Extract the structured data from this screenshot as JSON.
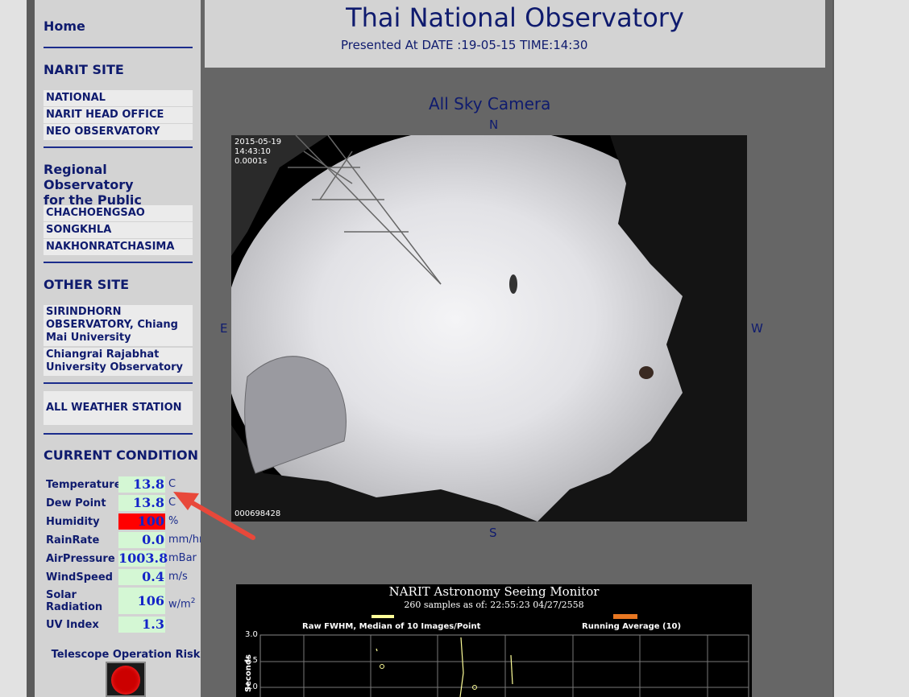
{
  "sidebar": {
    "home": "Home",
    "narit_site": {
      "heading": "NARIT SITE",
      "links": [
        "NATIONAL OBSERVATORY",
        "NARIT HEAD OFFICE",
        "NEO OBSERVATORY"
      ]
    },
    "regional": {
      "heading_line1": "Regional Observatory",
      "heading_line2": "for the Public",
      "links": [
        "CHACHOENGSAO",
        "SONGKHLA",
        "NAKHONRATCHASIMA"
      ]
    },
    "other_site": {
      "heading": "OTHER SITE",
      "links": [
        [
          "SIRINDHORN",
          "OBSERVATORY, Chiang",
          "Mai University"
        ],
        [
          "Chiangrai Rajabhat",
          "University Observatory"
        ]
      ]
    },
    "all_weather": "ALL WEATHER STATION",
    "current_condition": {
      "heading": "CURRENT CONDITION",
      "rows": [
        {
          "label": "Temperature",
          "value": "13.8",
          "unit": "C"
        },
        {
          "label": "Dew Point",
          "value": "13.8",
          "unit": "C"
        },
        {
          "label": "Humidity",
          "value": "100",
          "unit": "%"
        },
        {
          "label": "RainRate",
          "value": "0.0",
          "unit": "mm/hr"
        },
        {
          "label": "AirPressure",
          "value": "1003.8",
          "unit": "mBar"
        },
        {
          "label": "WindSpeed",
          "value": "0.4",
          "unit": "m/s"
        },
        {
          "label_line1": "Solar",
          "label_line2": "Radiation",
          "value": "106",
          "unit": "w/m",
          "unit_sup": "2"
        },
        {
          "label": "UV Index",
          "value": "1.3",
          "unit": ""
        }
      ],
      "humidity_alert_color": "#ff0000"
    },
    "telescope_risk": "Telescope Operation Risk",
    "risk_light_color": "#cc0000"
  },
  "main": {
    "title": "Thai National Observatory",
    "subtitle": "Presented At DATE :19-05-15 TIME:14:30",
    "camera": {
      "title": "All Sky Camera",
      "north": "N",
      "south": "S",
      "east": "E",
      "west": "W",
      "date": "2015-05-19",
      "time": "14:43:10",
      "exposure": "0.0001s",
      "frame_id": "000698428"
    },
    "seeing": {
      "title": "NARIT Astronomy Seeing Monitor",
      "subtitle": "260 samples as of: 22:55:23 04/27/2558",
      "legend_raw": "Raw FWHM, Median of 10 Images/Point",
      "legend_avg": "Running Average (10)",
      "legend_raw_color": "#ffff99",
      "legend_avg_color": "#e87722",
      "y_label": "Seconds",
      "y_ticks": [
        "3.0",
        "2.5",
        "2.0"
      ]
    }
  },
  "colors": {
    "heading": "#0f1b6e",
    "value_bg": "#d4f7d4",
    "value_text": "#1424c8",
    "annotation_arrow": "#e8483a"
  }
}
